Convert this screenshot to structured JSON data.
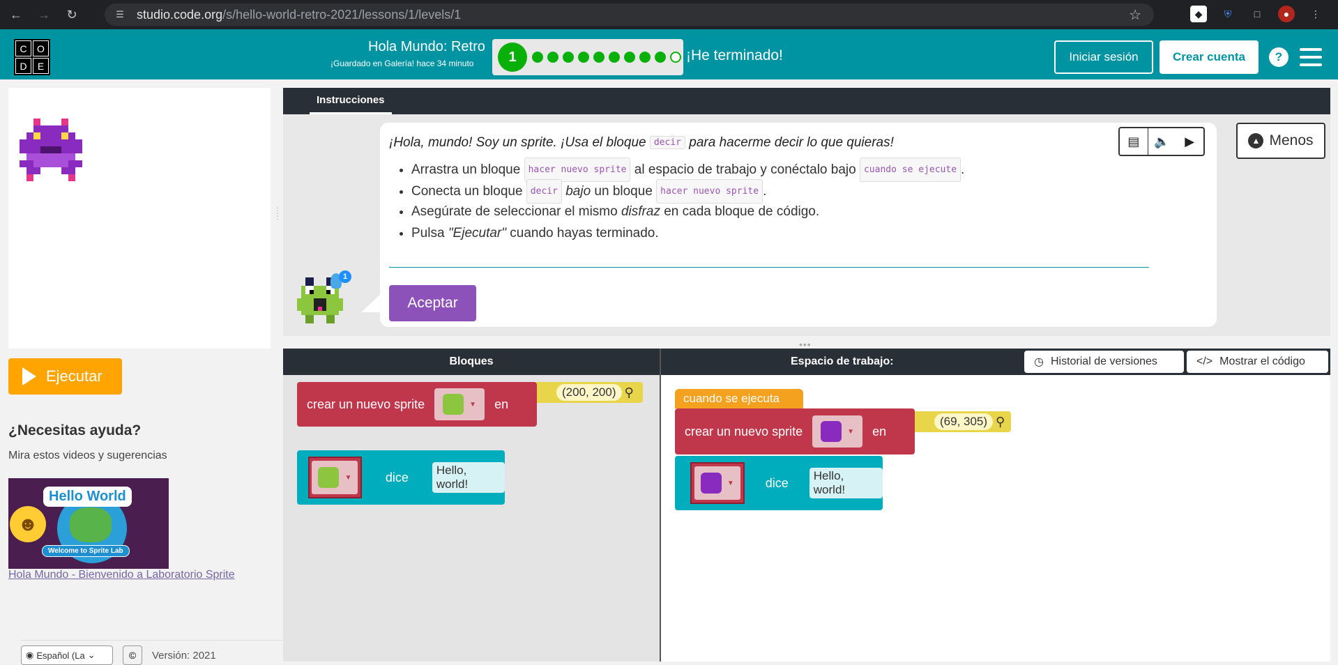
{
  "browser": {
    "url_host": "studio.code.org",
    "url_path": "/s/hello-world-retro-2021/lessons/1/levels/1"
  },
  "header": {
    "logo_letters": [
      "C",
      "O",
      "D",
      "E"
    ],
    "lesson_title": "Hola Mundo: Retro",
    "saved_status": "¡Guardado en Galería! hace 34 minuto",
    "current_level": "1",
    "progress": {
      "completed": 9,
      "total": 10
    },
    "finished_label": "¡He terminado!",
    "signin_label": "Iniciar sesión",
    "signup_label": "Crear cuenta",
    "help_label": "?"
  },
  "left": {
    "run_label": "Ejecutar",
    "help_title": "¿Necesitas ayuda?",
    "help_subtitle": "Mira estos videos y sugerencias",
    "video_title_overlay": "Hello World",
    "video_sub_overlay": "Welcome to Sprite Lab",
    "video_link": "Hola Mundo - Bienvenido a Laboratorio Sprite",
    "language": "Español (La",
    "copyright_symbol": "©",
    "version": "Versión: 2021"
  },
  "instructions": {
    "tab_label": "Instrucciones",
    "main_before": "¡Hola, mundo! Soy un sprite. ¡Usa el bloque ",
    "main_chip": "decir",
    "main_after": " para hacerme decir lo que quieras!",
    "b1_a": "Arrastra un bloque ",
    "b1_chip1": "hacer nuevo sprite",
    "b1_b": " al espacio de trabajo y conéctalo bajo ",
    "b1_chip2": "cuando se ejecute",
    "b1_c": ".",
    "b2_a": "Conecta un bloque ",
    "b2_chip1": "decir",
    "b2_em": " bajo",
    "b2_b": " un bloque ",
    "b2_chip2": "hacer nuevo sprite",
    "b2_c": ".",
    "b3_a": "Asegúrate de seleccionar el mismo ",
    "b3_em": "disfraz",
    "b3_b": " en cada bloque de código.",
    "b4_a": "Pulsa ",
    "b4_em": "\"Ejecutar\"",
    "b4_b": " cuando hayas terminado.",
    "accept_label": "Aceptar",
    "less_label": "Menos",
    "hint_count": "1"
  },
  "workspace": {
    "blocks_header": "Bloques",
    "workspace_header": "Espacio de trabajo:",
    "history_label": "Historial de versiones",
    "show_code_label": "Mostrar el código",
    "toolbox_create_label": "crear un nuevo sprite",
    "toolbox_en": "en",
    "toolbox_coord": "(200, 200)",
    "toolbox_says": "dice",
    "toolbox_says_text": "Hello, world!",
    "event_label": "cuando se ejecuta",
    "ws_create_label": "crear un nuevo sprite",
    "ws_en": "en",
    "ws_coord": "(69, 305)",
    "ws_says": "dice",
    "ws_says_text": "Hello, world!"
  },
  "colors": {
    "header_teal": "#0094a3",
    "run_orange": "#ffa400",
    "accept_purple": "#8c52ba",
    "block_red": "#c0364a",
    "block_teal": "#00adbc",
    "event_orange": "#f3a11e",
    "progress_green": "#0ab00a"
  }
}
